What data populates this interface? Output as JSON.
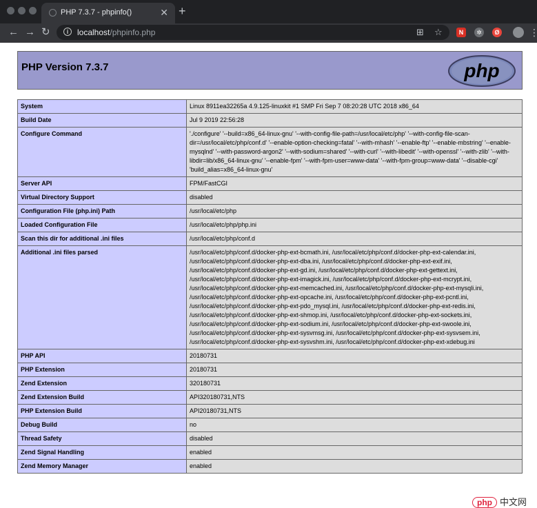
{
  "browser": {
    "tab_title": "PHP 7.3.7 - phpinfo()",
    "tab_close": "✕",
    "new_tab": "+",
    "url_host": "localhost",
    "url_path": "/phpinfo.php",
    "nav": {
      "back": "←",
      "forward": "→",
      "reload": "↻"
    }
  },
  "page": {
    "title": "PHP Version 7.3.7",
    "logo_text": "php",
    "rows": [
      {
        "key": "System",
        "value": "Linux 8911ea32265a 4.9.125-linuxkit #1 SMP Fri Sep 7 08:20:28 UTC 2018 x86_64"
      },
      {
        "key": "Build Date",
        "value": "Jul 9 2019 22:56:28"
      },
      {
        "key": "Configure Command",
        "value": "'./configure' '--build=x86_64-linux-gnu' '--with-config-file-path=/usr/local/etc/php' '--with-config-file-scan-dir=/usr/local/etc/php/conf.d' '--enable-option-checking=fatal' '--with-mhash' '--enable-ftp' '--enable-mbstring' '--enable-mysqlnd' '--with-password-argon2' '--with-sodium=shared' '--with-curl' '--with-libedit' '--with-openssl' '--with-zlib' '--with-libdir=lib/x86_64-linux-gnu' '--enable-fpm' '--with-fpm-user=www-data' '--with-fpm-group=www-data' '--disable-cgi' 'build_alias=x86_64-linux-gnu'"
      },
      {
        "key": "Server API",
        "value": "FPM/FastCGI"
      },
      {
        "key": "Virtual Directory Support",
        "value": "disabled"
      },
      {
        "key": "Configuration File (php.ini) Path",
        "value": "/usr/local/etc/php"
      },
      {
        "key": "Loaded Configuration File",
        "value": "/usr/local/etc/php/php.ini"
      },
      {
        "key": "Scan this dir for additional .ini files",
        "value": "/usr/local/etc/php/conf.d"
      },
      {
        "key": "Additional .ini files parsed",
        "value": "/usr/local/etc/php/conf.d/docker-php-ext-bcmath.ini, /usr/local/etc/php/conf.d/docker-php-ext-calendar.ini, /usr/local/etc/php/conf.d/docker-php-ext-dba.ini, /usr/local/etc/php/conf.d/docker-php-ext-exif.ini, /usr/local/etc/php/conf.d/docker-php-ext-gd.ini, /usr/local/etc/php/conf.d/docker-php-ext-gettext.ini, /usr/local/etc/php/conf.d/docker-php-ext-imagick.ini, /usr/local/etc/php/conf.d/docker-php-ext-mcrypt.ini, /usr/local/etc/php/conf.d/docker-php-ext-memcached.ini, /usr/local/etc/php/conf.d/docker-php-ext-mysqli.ini, /usr/local/etc/php/conf.d/docker-php-ext-opcache.ini, /usr/local/etc/php/conf.d/docker-php-ext-pcntl.ini, /usr/local/etc/php/conf.d/docker-php-ext-pdo_mysql.ini, /usr/local/etc/php/conf.d/docker-php-ext-redis.ini, /usr/local/etc/php/conf.d/docker-php-ext-shmop.ini, /usr/local/etc/php/conf.d/docker-php-ext-sockets.ini, /usr/local/etc/php/conf.d/docker-php-ext-sodium.ini, /usr/local/etc/php/conf.d/docker-php-ext-swoole.ini, /usr/local/etc/php/conf.d/docker-php-ext-sysvmsg.ini, /usr/local/etc/php/conf.d/docker-php-ext-sysvsem.ini, /usr/local/etc/php/conf.d/docker-php-ext-sysvshm.ini, /usr/local/etc/php/conf.d/docker-php-ext-xdebug.ini"
      },
      {
        "key": "PHP API",
        "value": "20180731"
      },
      {
        "key": "PHP Extension",
        "value": "20180731"
      },
      {
        "key": "Zend Extension",
        "value": "320180731"
      },
      {
        "key": "Zend Extension Build",
        "value": "API320180731,NTS"
      },
      {
        "key": "PHP Extension Build",
        "value": "API20180731,NTS"
      },
      {
        "key": "Debug Build",
        "value": "no"
      },
      {
        "key": "Thread Safety",
        "value": "disabled"
      },
      {
        "key": "Zend Signal Handling",
        "value": "enabled"
      },
      {
        "key": "Zend Memory Manager",
        "value": "enabled"
      }
    ]
  },
  "watermark": {
    "badge": "php",
    "text": "中文网"
  }
}
